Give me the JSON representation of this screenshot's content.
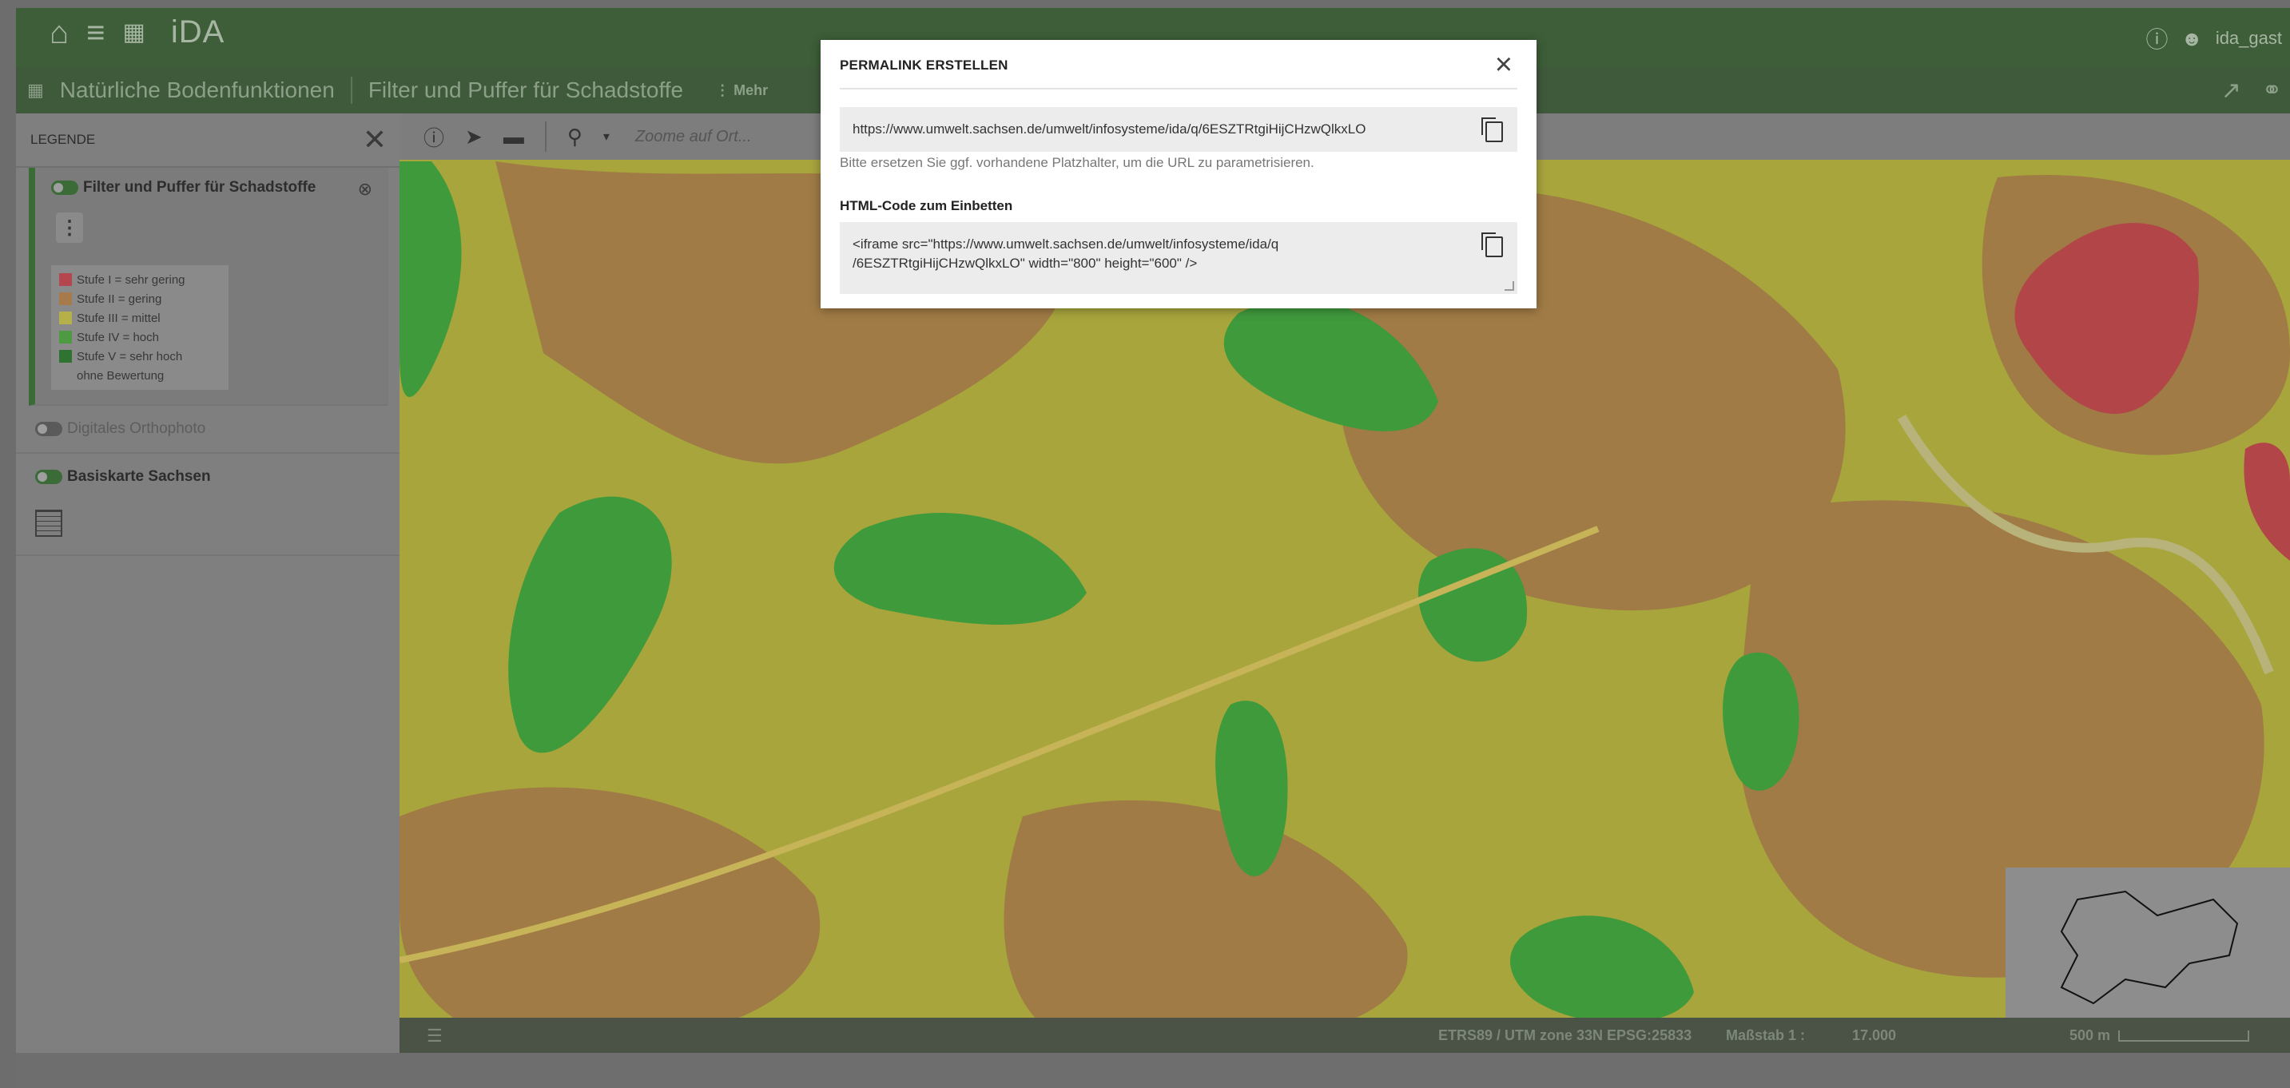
{
  "topbar": {
    "brand": "iDA",
    "user": "ida_gast",
    "icons": [
      "home-icon",
      "menu-icon",
      "map-icon",
      "help-icon",
      "user-icon"
    ]
  },
  "subbar": {
    "map_title": "Natürliche Bodenfunktionen",
    "theme": "Filter und Puffer für Schadstoffe",
    "more_label": "Mehr"
  },
  "legend": {
    "title": "LEGENDE",
    "layers": [
      {
        "name": "Filter und Puffer für Schadstoffe",
        "active": true,
        "items": [
          {
            "label": "Stufe I = sehr gering",
            "color": "#b3464f"
          },
          {
            "label": "Stufe II = gering",
            "color": "#a67a4b"
          },
          {
            "label": "Stufe III = mittel",
            "color": "#b5b04a"
          },
          {
            "label": "Stufe IV = hoch",
            "color": "#4d9a43"
          },
          {
            "label": "Stufe V = sehr hoch",
            "color": "#2f7232"
          },
          {
            "label": "ohne Bewertung",
            "color": "#8a8a8a"
          }
        ]
      },
      {
        "name": "Digitales Orthophoto",
        "active": false
      },
      {
        "name": "Basiskarte Sachsen",
        "active": true
      }
    ]
  },
  "map": {
    "search_placeholder": "Zoome auf Ort...",
    "crs": "ETRS89 / UTM zone 33N EPSG:25833",
    "scale_label": "Maßstab 1 :",
    "scale_value": "17.000",
    "scalebar_label": "500 m",
    "colors": {
      "stufe_I": "#c0404a",
      "stufe_II": "#a07b45",
      "stufe_III": "#a6a33c",
      "stufe_IV": "#3f9a3c"
    }
  },
  "modal": {
    "title": "PERMALINK ERSTELLEN",
    "permalink_url": "https://www.umwelt.sachsen.de/umwelt/infosysteme/ida/q/6ESZTRtgiHijCHzwQlkxLO",
    "hint": "Bitte ersetzen Sie ggf. vorhandene Platzhalter, um die URL zu parametrisieren.",
    "embed_label": "HTML-Code zum Einbetten",
    "embed_code_line1": "<iframe src=\"https://www.umwelt.sachsen.de/umwelt/infosysteme/ida/q",
    "embed_code_line2": "/6ESZTRtgiHijCHzwQlkxLO\" width=\"800\" height=\"600\" />"
  }
}
